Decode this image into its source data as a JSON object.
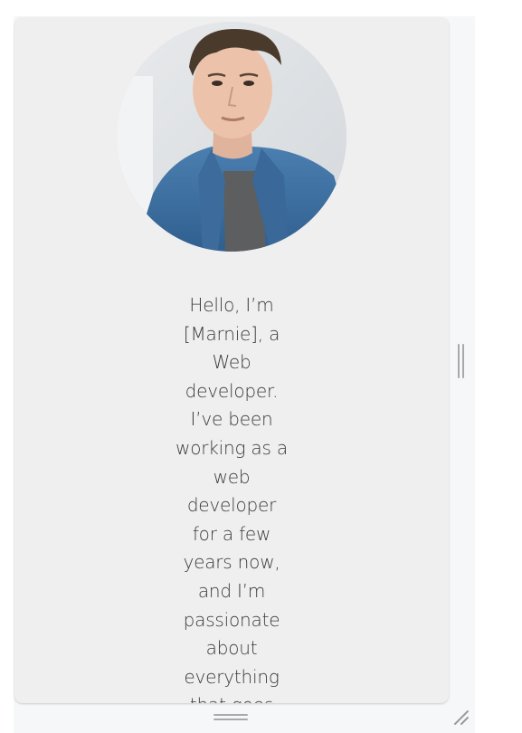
{
  "profile": {
    "photo_icon": "person-portrait-photo",
    "bio_text": "Hello, I’m [Marnie], a Web developer. I’ve been working as a web developer for a few years now, and I’m passionate about everything that goes"
  },
  "controls": {
    "right_handle_icon": "vertical-resize-handle-icon",
    "bottom_handle_icon": "horizontal-resize-handle-icon",
    "corner_icon": "corner-resize-grip-icon"
  },
  "colors": {
    "card_background": "#efefef",
    "frame_background": "#f6f7f9",
    "text": "#3a3a3a",
    "handle": "#a9a9a9",
    "denim": "#3f6f9e"
  }
}
